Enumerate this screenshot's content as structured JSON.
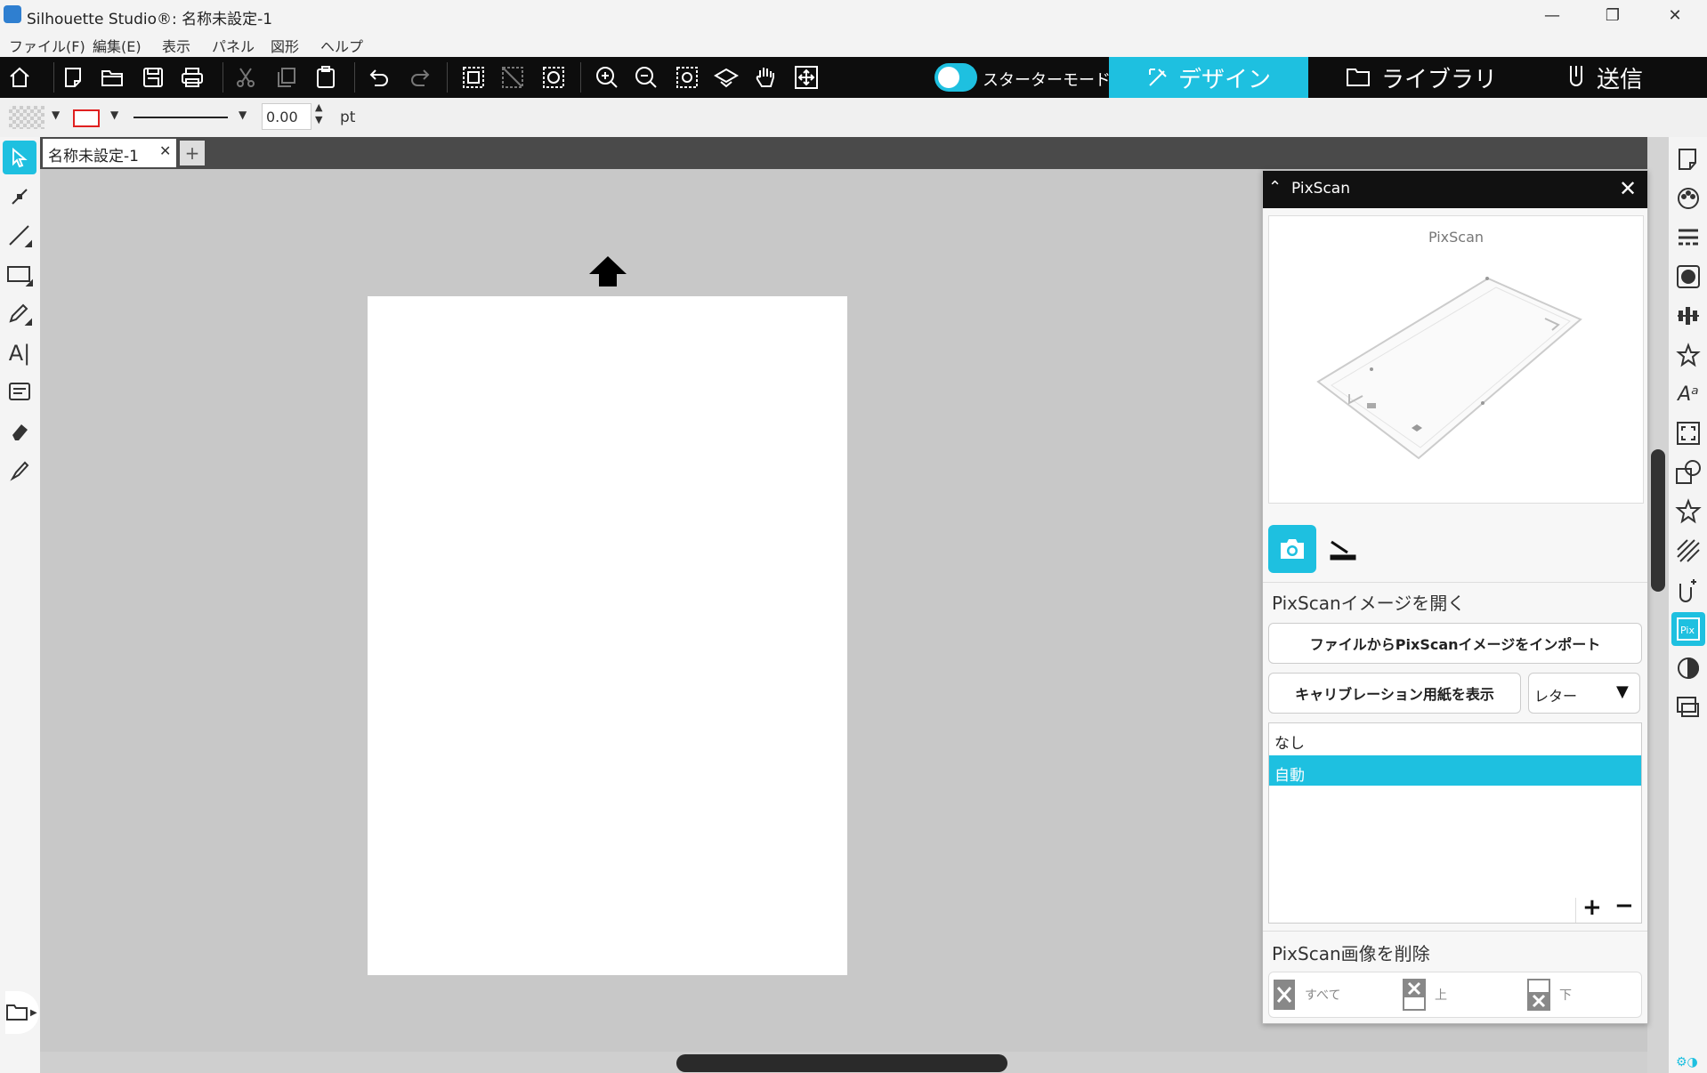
{
  "window": {
    "title": "Silhouette Studio®: 名称未設定-1"
  },
  "menu": [
    "ファイル(F)",
    "編集(E)",
    "表示",
    "パネル",
    "図形",
    "ヘルプ"
  ],
  "toolbar": {
    "mode_label": "スターターモードオフ",
    "tabs": {
      "design": "デザイン",
      "library": "ライブラリ",
      "send": "送信"
    }
  },
  "properties": {
    "line_width": "0.00",
    "unit": "pt"
  },
  "document": {
    "tab_label": "名称未設定-1"
  },
  "pixscan": {
    "panel_title": "PixScan",
    "preview_label": "PixScan",
    "open_section": "PixScanイメージを開く",
    "import_button": "ファイルからPixScanイメージをインポート",
    "calibration_button": "キャリブレーション用紙を表示",
    "paper_size": "レター",
    "list_items": [
      "なし",
      "自動"
    ],
    "selected_index": 1,
    "delete_section": "PixScan画像を削除",
    "delete_buttons": {
      "all": "すべて",
      "top": "上",
      "bottom": "下"
    }
  },
  "colors": {
    "accent": "#1ec0e0",
    "toolbar_bg": "#0d0d0d"
  }
}
